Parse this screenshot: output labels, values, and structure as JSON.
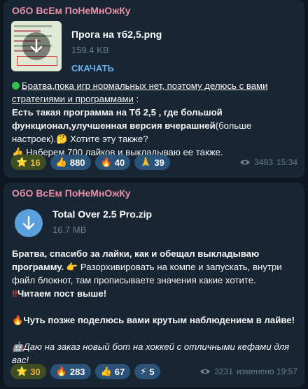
{
  "messages": [
    {
      "sender": "ОбО ВсЕм ПоНеМнОжКу",
      "file": {
        "name": "Прога на тб2,5.png",
        "size": "159.4 KB",
        "action": "СКАЧАТЬ"
      },
      "text": {
        "line1": "Братва,пока игр нормальных нет, поэтому делюсь с вами стратегиями и программами",
        "line1_tail": " :",
        "line2": "Есть такая программа на Тб 2,5 , где большой функционал,улучшенная версия вчерашней",
        "line2_tail": "(больше настроек).",
        "line2_q": " Хотите эту также?",
        "line3": " Наберем 700 лайков и выкладываю ее также."
      },
      "reactions": [
        {
          "emoji": "⭐",
          "count": "16",
          "selected": true
        },
        {
          "emoji": "👍",
          "count": "880"
        },
        {
          "emoji": "🔥",
          "count": "40"
        },
        {
          "emoji": "🙏",
          "count": "39"
        }
      ],
      "views": "3483",
      "time": "15:34"
    },
    {
      "sender": "ОбО ВсЕм ПоНеМнОжКу",
      "file": {
        "name": "Total Over 2.5 Pro.zip",
        "size": "16.7 MB"
      },
      "text": {
        "p1_bold": "Братва, спасибо за лайки, как и обещал выкладываю программу.",
        "p1_rest": " Разорхивировать на компе и запускать, внутри файл блокнот, там прописываете значения какие хотите.",
        "p2": "Читаем пост выше!",
        "p3": "Чуть позже поделюсь вами крутым наблюдением в лайве!",
        "p4": "Даю на заказ новый бот на хоккей с отличными кефами для вас!"
      },
      "reactions": [
        {
          "emoji": "⭐",
          "count": "30",
          "selected": true
        },
        {
          "emoji": "🔥",
          "count": "283"
        },
        {
          "emoji": "👍",
          "count": "67"
        },
        {
          "emoji": "⚡",
          "count": "5"
        }
      ],
      "views": "3231",
      "time": "изменено 19:57"
    }
  ],
  "colors": {
    "background": "#0e1621",
    "bubble": "#182533",
    "sender": "#e88ea6",
    "link": "#6ab2f2",
    "reaction": "#2b5278"
  },
  "icons": [
    "download-arrow-icon",
    "eye-icon",
    "green-circle-icon",
    "thumbs-up-icon",
    "fire-icon",
    "star-icon",
    "pray-icon",
    "lightning-icon",
    "robot-icon",
    "exclamation-icon",
    "pointing-right-icon",
    "thinking-face-icon"
  ]
}
